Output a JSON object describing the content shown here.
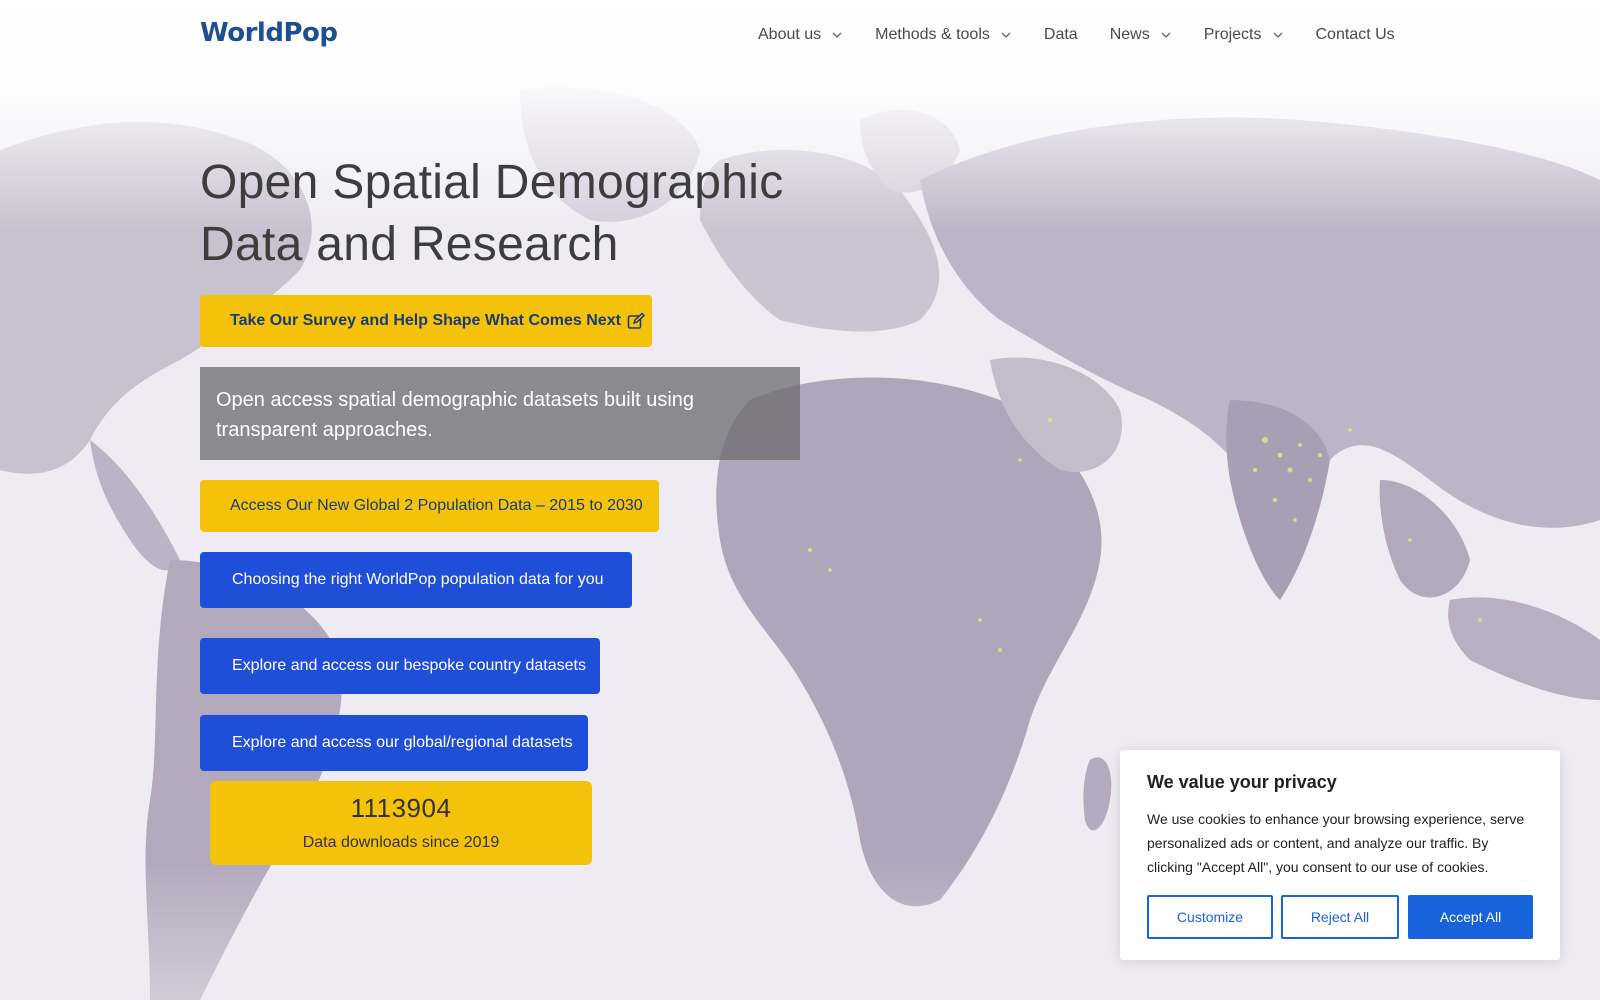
{
  "header": {
    "logo_main": "WorldPop",
    "nav": [
      {
        "label": "About us",
        "has_dropdown": true
      },
      {
        "label": "Methods & tools",
        "has_dropdown": true
      },
      {
        "label": "Data",
        "has_dropdown": false
      },
      {
        "label": "News",
        "has_dropdown": true
      },
      {
        "label": "Projects",
        "has_dropdown": true
      },
      {
        "label": "Contact Us",
        "has_dropdown": false
      }
    ]
  },
  "hero": {
    "title": "Open Spatial Demographic Data and Research",
    "survey_button": "Take Our Survey and Help Shape What Comes Next",
    "intro": "Open access spatial demographic datasets built using transparent approaches.",
    "global2_button": "Access Our New Global 2 Population Data – 2015 to 2030",
    "choose_button": "Choosing the right WorldPop population data for you",
    "bespoke_button": "Explore and access our bespoke country datasets",
    "global_button": "Explore and access our global/regional datasets",
    "stats": {
      "downloads": "1113904",
      "downloads_label": "Data downloads since 2019"
    }
  },
  "cookie": {
    "title": "We value your privacy",
    "text": "We use cookies to enhance your browsing experience, serve personalized ads or content, and analyze our traffic. By clicking \"Accept All\", you consent to our use of cookies.",
    "customize": "Customize",
    "reject": "Reject All",
    "accept": "Accept All"
  },
  "colors": {
    "brand_blue": "#1d4f94",
    "accent_yellow": "#f5c20b",
    "button_blue": "#1f4fd8",
    "cookie_blue": "#1863dc",
    "map_land": "#b3a9bd"
  },
  "icons": [
    "chevron-down-icon",
    "edit-icon"
  ]
}
